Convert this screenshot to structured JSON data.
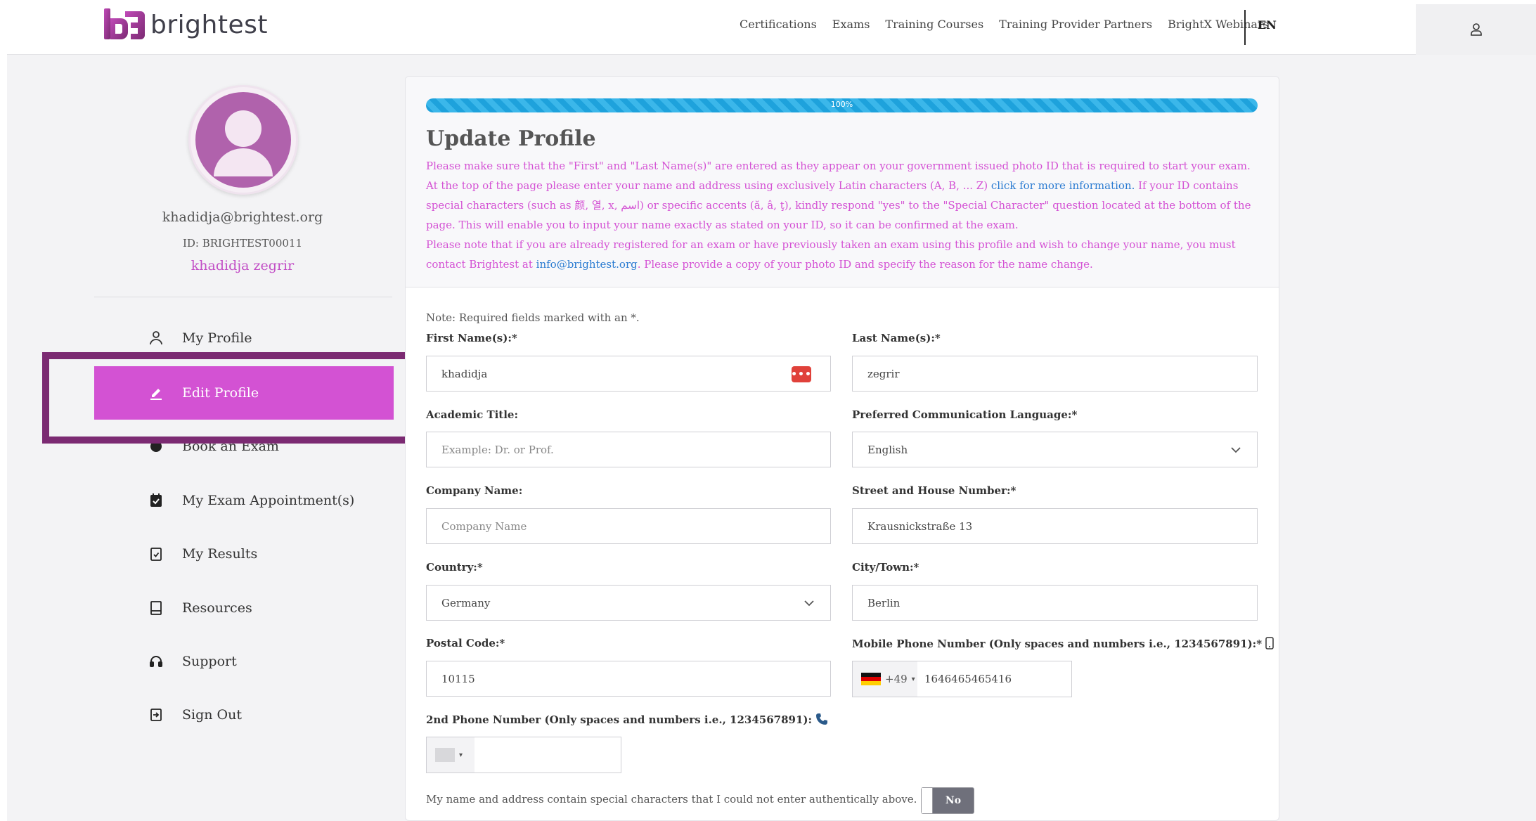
{
  "brand": {
    "name": "brightest"
  },
  "nav": {
    "items": [
      "Certifications",
      "Exams",
      "Training Courses",
      "Training Provider Partners",
      "BrightX Webinars"
    ],
    "language": "EN"
  },
  "profile": {
    "email": "khadidja@brightest.org",
    "id": "ID: BRIGHTEST00011",
    "name": "khadidja zegrir"
  },
  "sidebar": {
    "items": [
      {
        "label": "My Profile",
        "icon": "person-icon"
      },
      {
        "label": "Edit Profile",
        "icon": "pencil-icon"
      },
      {
        "label": "Book an Exam",
        "icon": "book-exam-icon"
      },
      {
        "label": "My Exam Appointment(s)",
        "icon": "calendar-check-icon"
      },
      {
        "label": "My Results",
        "icon": "clipboard-check-icon"
      },
      {
        "label": "Resources",
        "icon": "book-icon"
      },
      {
        "label": "Support",
        "icon": "headset-icon"
      },
      {
        "label": "Sign Out",
        "icon": "sign-out-icon"
      }
    ],
    "active_index": 1
  },
  "form": {
    "progress": {
      "value": 100,
      "label": "100%"
    },
    "title": "Update Profile",
    "intro": {
      "p1a": "Please make sure that the \"First\" and \"Last Name(s)\" are entered as they appear on your government issued photo ID that is required to start your exam. At the top of the page please enter your name and address using exclusively Latin characters (A, B, ... Z) ",
      "p1_link": "click for more information.",
      "p1b": " If your ID contains special characters (such as 颜, 열, ⅹ, اسم) or specific accents (ă, â, ţ), kindly respond \"yes\" to the \"Special Character\" question located at the bottom of the page. This will enable you to input your name exactly as stated on your ID, so it can be confirmed at the exam.",
      "p2a": "Please note that if you are already registered for an exam or have previously taken an exam using this profile and wish to change your name, you must contact Brightest at ",
      "p2_link": "info@brightest.org",
      "p2b": ". Please provide a copy of your photo ID and specify the reason for the name change."
    },
    "note": "Note: Required fields marked with an *.",
    "first_name": {
      "label": "First Name(s):*",
      "value": "khadidja"
    },
    "last_name": {
      "label": "Last Name(s):*",
      "value": "zegrir"
    },
    "academic_title": {
      "label": "Academic Title:",
      "placeholder": "Example: Dr. or Prof."
    },
    "language": {
      "label": "Preferred Communication Language:*",
      "value": "English"
    },
    "company": {
      "label": "Company Name:",
      "placeholder": "Company Name"
    },
    "street": {
      "label": "Street and House Number:*",
      "value": "Krausnickstraße 13"
    },
    "country": {
      "label": "Country:*",
      "value": "Germany"
    },
    "city": {
      "label": "City/Town:*",
      "value": "Berlin"
    },
    "postal": {
      "label": "Postal Code:*",
      "value": "10115"
    },
    "mobile": {
      "label": "Mobile Phone Number (Only spaces and numbers i.e., 1234567891):*",
      "code": "+49",
      "value": "1646465465416"
    },
    "phone2": {
      "label": "2nd Phone Number (Only spaces and numbers i.e., 1234567891):"
    },
    "special_chars": {
      "label": "My name and address contain special characters that I could not enter authentically above.",
      "toggle": "No"
    }
  }
}
